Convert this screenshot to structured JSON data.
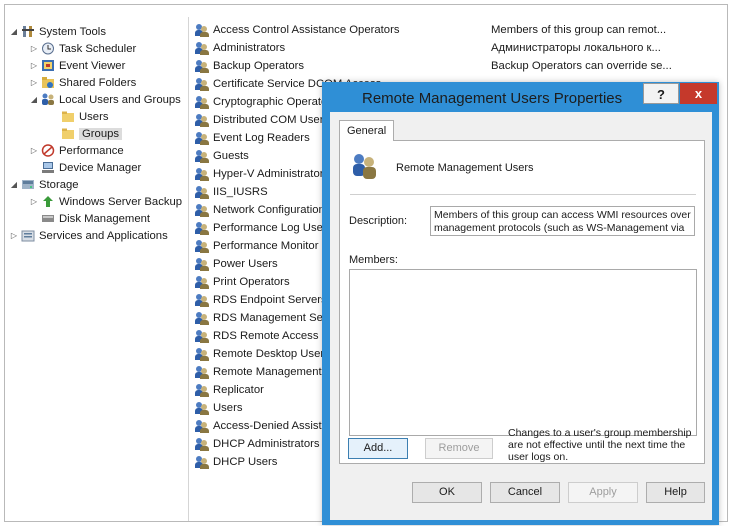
{
  "tree": [
    {
      "label": "System Tools",
      "arrow": "◢",
      "icon": "tools-icon"
    },
    {
      "label": "Task Scheduler",
      "arrow": "▷",
      "icon": "clock-icon"
    },
    {
      "label": "Event Viewer",
      "arrow": "▷",
      "icon": "event-viewer-icon"
    },
    {
      "label": "Shared Folders",
      "arrow": "▷",
      "icon": "shared-folder-icon"
    },
    {
      "label": "Local Users and Groups",
      "arrow": "◢",
      "icon": "users-icon"
    },
    {
      "label": "Users",
      "arrow": "",
      "icon": "folder-icon"
    },
    {
      "label": "Groups",
      "arrow": "",
      "icon": "folder-icon"
    },
    {
      "label": "Performance",
      "arrow": "▷",
      "icon": "performance-icon"
    },
    {
      "label": "Device Manager",
      "arrow": "",
      "icon": "device-manager-icon"
    },
    {
      "label": "Storage",
      "arrow": "◢",
      "icon": "storage-icon"
    },
    {
      "label": "Windows Server Backup",
      "arrow": "▷",
      "icon": "backup-icon"
    },
    {
      "label": "Disk Management",
      "arrow": "",
      "icon": "disk-icon"
    },
    {
      "label": "Services and Applications",
      "arrow": "▷",
      "icon": "services-icon"
    }
  ],
  "groups": [
    "Access Control Assistance Operators",
    "Administrators",
    "Backup Operators",
    "Certificate Service DCOM Access",
    "Cryptographic Operators",
    "Distributed COM Users",
    "Event Log Readers",
    "Guests",
    "Hyper-V Administrators",
    "IIS_IUSRS",
    "Network Configuration Operators",
    "Performance Log Users",
    "Performance Monitor Users",
    "Power Users",
    "Print Operators",
    "RDS Endpoint Servers",
    "RDS Management Servers",
    "RDS Remote Access Servers",
    "Remote Desktop Users",
    "Remote Management Users",
    "Replicator",
    "Users",
    "Access-Denied Assistance Users",
    "DHCP Administrators",
    "DHCP Users"
  ],
  "descriptions": [
    "Members of this group can remot...",
    "Администраторы локального к...",
    "Backup Operators can override se..."
  ],
  "dialog": {
    "title": "Remote Management Users Properties",
    "help_label": "?",
    "close_label": "x",
    "tab_label": "General",
    "group_name": "Remote Management Users",
    "description_label": "Description:",
    "description_lines": [
      "Members of this group can access WMI resources over",
      "management protocols (such as WS-Management via"
    ],
    "members_label": "Members:",
    "add_label": "Add...",
    "remove_label": "Remove",
    "note_lines": [
      "Changes to a user's group membership",
      "are not effective until the next time the",
      "user logs on."
    ],
    "ok_label": "OK",
    "cancel_label": "Cancel",
    "apply_label": "Apply",
    "help_button_label": "Help"
  },
  "colors": {
    "title_bar": "#2f8fd6",
    "close_button": "#c5392b"
  }
}
